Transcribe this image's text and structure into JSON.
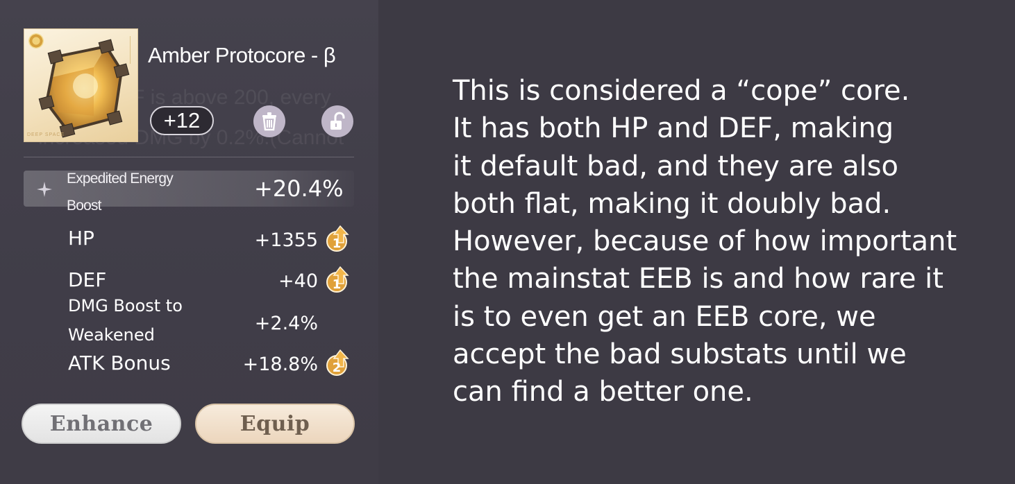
{
  "item": {
    "name": "Amber Protocore - β",
    "level": "+12",
    "thumb_corner_text": "DEEP SPACE",
    "background_text": [
      "F is above 200, every",
      "increased DMG by 0.2%.(Cannot"
    ]
  },
  "main_stat": {
    "name": "Expedited Energy Boost",
    "name_line1": "Expedited Energy",
    "name_line2": "Boost",
    "value": "+20.4%"
  },
  "substats": [
    {
      "name": "HP",
      "value": "+1355",
      "rolls": "1"
    },
    {
      "name": "DEF",
      "value": "+40",
      "rolls": "1"
    },
    {
      "name_line1": "DMG Boost to",
      "name_line2": "Weakened",
      "value": "+2.4%",
      "rolls": ""
    },
    {
      "name": "ATK Bonus",
      "value": "+18.8%",
      "rolls": "2"
    }
  ],
  "buttons": {
    "enhance": "Enhance",
    "equip": "Equip"
  },
  "icons": {
    "discard": "trash-icon",
    "lock": "unlock-icon",
    "main_stat": "sparkle-icon",
    "roll": "upgrade-arrow-icon"
  },
  "colors": {
    "background": "#3d3a44",
    "roll_badge": "#e0a13a",
    "equip_button": "#ecd6bd"
  },
  "commentary": [
    "This is considered a “cope” core.",
    "It has both HP and DEF, making",
    "it default bad, and they are also",
    "both flat, making it doubly bad.",
    "However, because of how important",
    "the mainstat EEB is and how rare it",
    "is to even get an EEB core, we",
    "accept the bad substats until we",
    "can find a better one."
  ]
}
